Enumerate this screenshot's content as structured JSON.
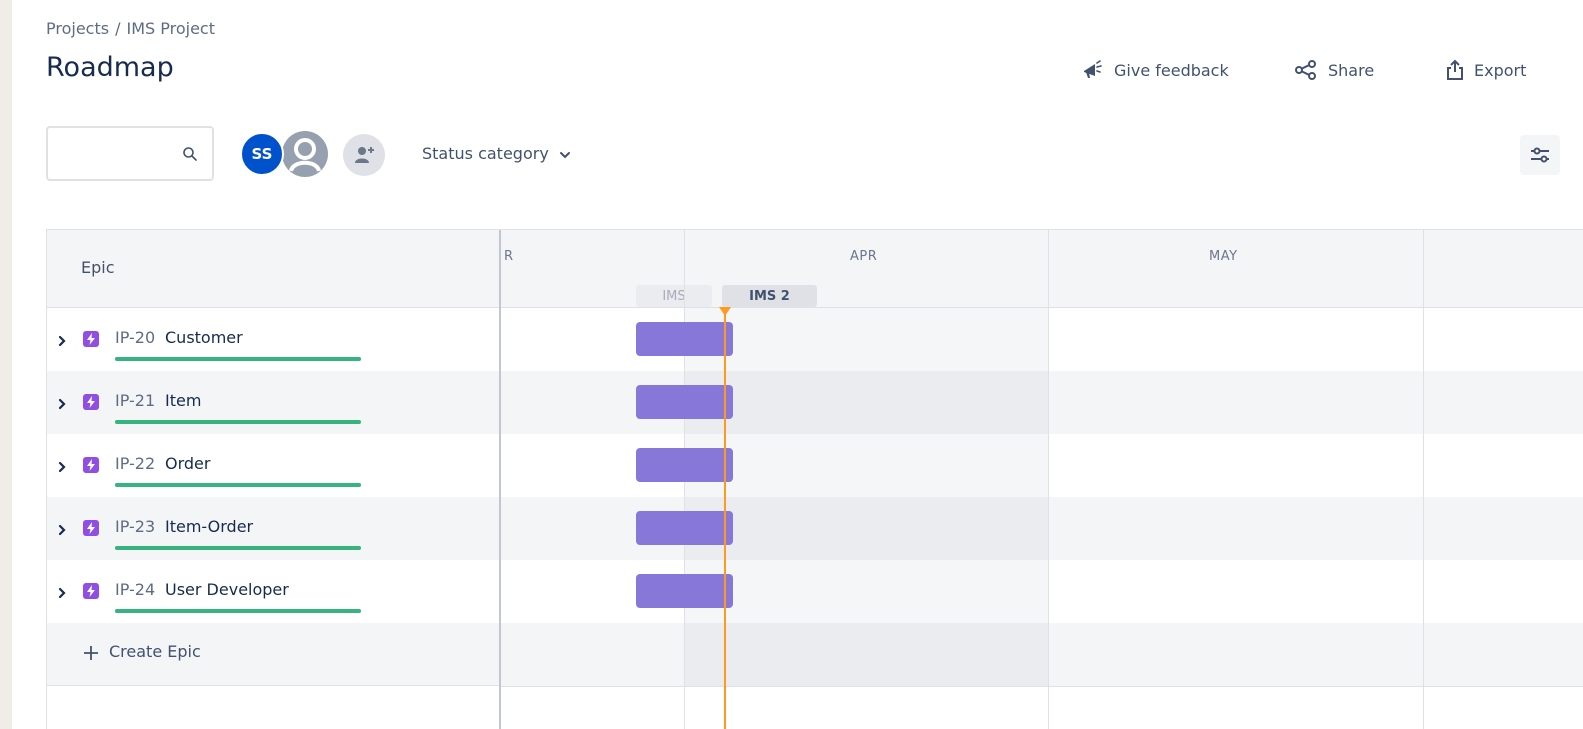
{
  "breadcrumb": {
    "projects": "Projects",
    "separator": "/",
    "project": "IMS Project"
  },
  "page": {
    "title": "Roadmap"
  },
  "header_actions": {
    "feedback_label": "Give feedback",
    "share_label": "Share",
    "export_label": "Export"
  },
  "toolbar": {
    "search_value": "",
    "search_placeholder": "",
    "avatar_initials": "SS",
    "status_filter_label": "Status category"
  },
  "roadmap": {
    "epic_column_label": "Epic",
    "months": {
      "prev": "R",
      "apr": "APR",
      "may": "MAY"
    },
    "sprints": {
      "past": "IMS",
      "current": "IMS 2"
    },
    "create_label": "Create Epic",
    "epics": [
      {
        "key": "IP-20",
        "title": "Customer",
        "progress": 1.0
      },
      {
        "key": "IP-21",
        "title": "Item",
        "progress": 1.0
      },
      {
        "key": "IP-22",
        "title": "Order",
        "progress": 1.0
      },
      {
        "key": "IP-23",
        "title": "Item-Order",
        "progress": 1.0
      },
      {
        "key": "IP-24",
        "title": "User Developer",
        "progress": 1.0
      }
    ]
  },
  "colors": {
    "brand": "#0052cc",
    "epic_bar": "#8777d9",
    "epic_icon": "#904ee2",
    "progress": "#36b37e",
    "today_line": "#ff991f"
  }
}
